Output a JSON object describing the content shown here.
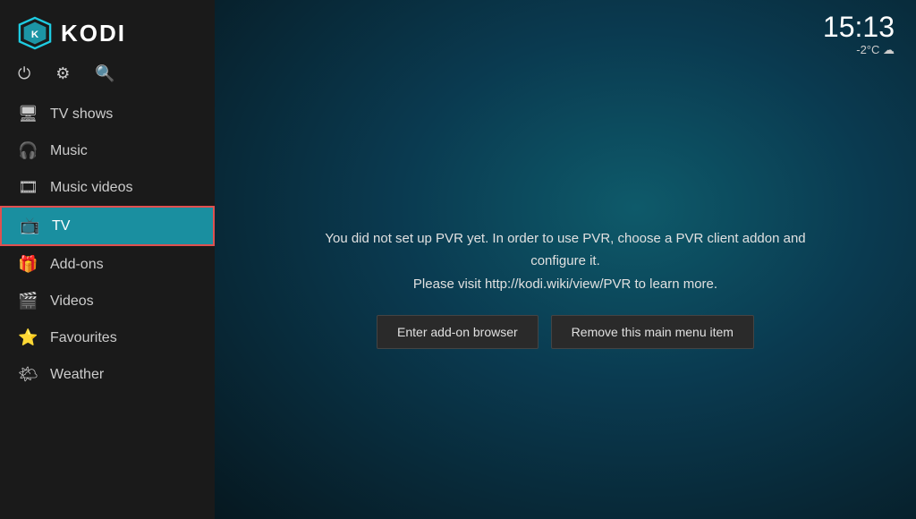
{
  "app": {
    "name": "KODI"
  },
  "clock": {
    "time": "15:13",
    "weather": "-2°C ☁"
  },
  "top_icons": [
    {
      "name": "power-icon",
      "symbol": "⏻"
    },
    {
      "name": "settings-icon",
      "symbol": "⚙"
    },
    {
      "name": "search-icon",
      "symbol": "🔍"
    }
  ],
  "nav": {
    "items": [
      {
        "id": "tv-shows",
        "label": "TV shows",
        "icon": "🖥",
        "active": false
      },
      {
        "id": "music",
        "label": "Music",
        "icon": "🎧",
        "active": false
      },
      {
        "id": "music-videos",
        "label": "Music videos",
        "icon": "🎞",
        "active": false
      },
      {
        "id": "tv",
        "label": "TV",
        "icon": "📺",
        "active": true
      },
      {
        "id": "add-ons",
        "label": "Add-ons",
        "icon": "🎁",
        "active": false
      },
      {
        "id": "videos",
        "label": "Videos",
        "icon": "🎬",
        "active": false
      },
      {
        "id": "favourites",
        "label": "Favourites",
        "icon": "⭐",
        "active": false
      },
      {
        "id": "weather",
        "label": "Weather",
        "icon": "🌤",
        "active": false
      }
    ]
  },
  "pvr": {
    "message_line1": "You did not set up PVR yet. In order to use PVR, choose a PVR client addon and configure it.",
    "message_line2": "Please visit http://kodi.wiki/view/PVR to learn more.",
    "btn_addon_browser": "Enter add-on browser",
    "btn_remove": "Remove this main menu item"
  }
}
